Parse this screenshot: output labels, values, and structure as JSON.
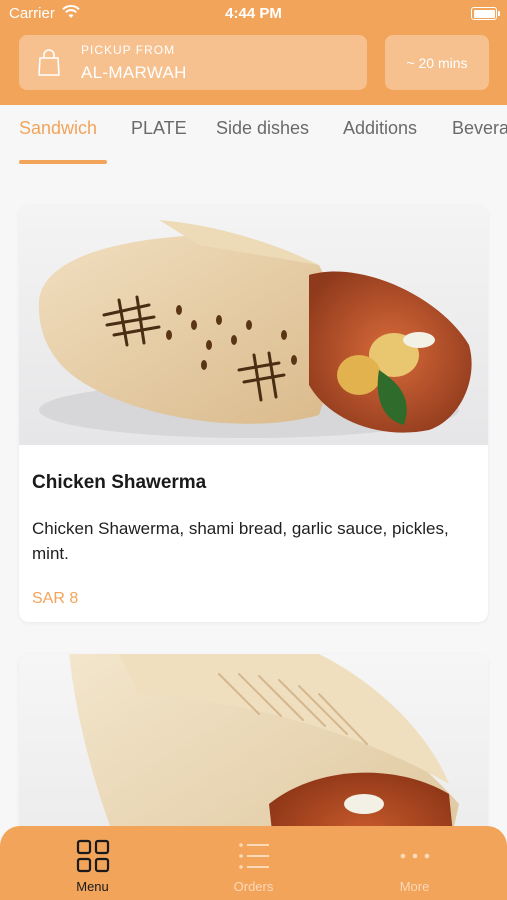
{
  "status_bar": {
    "carrier": "Carrier",
    "time": "4:44 PM"
  },
  "header": {
    "pickup_label": "PICKUP FROM",
    "pickup_location": "AL-MARWAH",
    "eta": "~ 20 mins"
  },
  "tabs": [
    {
      "label": "Sandwich",
      "active": true
    },
    {
      "label": "PLATE",
      "active": false
    },
    {
      "label": "Side dishes",
      "active": false
    },
    {
      "label": "Additions",
      "active": false
    },
    {
      "label": "Beverages",
      "active": false
    }
  ],
  "menu_items": [
    {
      "title": "Chicken Shawerma",
      "description": "Chicken Shawerma, shami bread, garlic sauce, pickles, mint.",
      "price": "SAR 8"
    },
    {
      "title": "",
      "description": "",
      "price": ""
    }
  ],
  "bottom_nav": [
    {
      "label": "Menu",
      "icon": "grid-icon",
      "active": true
    },
    {
      "label": "Orders",
      "icon": "list-icon",
      "active": false
    },
    {
      "label": "More",
      "icon": "more-dots-icon",
      "active": false
    }
  ],
  "colors": {
    "accent": "#f2a45a",
    "accent_light": "#f6c18f",
    "background": "#f7f7f7"
  }
}
